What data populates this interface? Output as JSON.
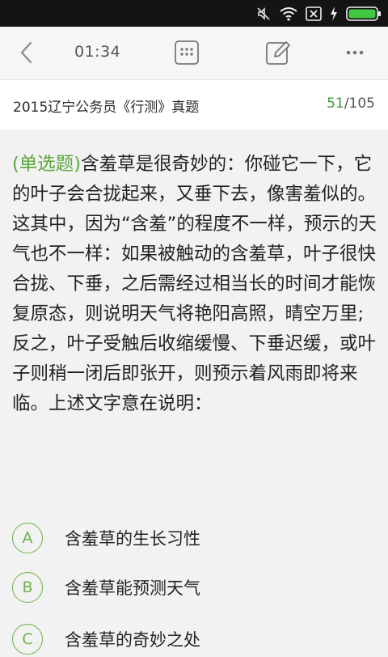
{
  "status_bar": {
    "icons": [
      "mute-icon",
      "wifi-icon",
      "no-sim-icon",
      "charging-icon",
      "battery-icon"
    ],
    "battery_color": "#42c742"
  },
  "toolbar": {
    "time": "01:34",
    "icons": [
      "back-icon",
      "grid-icon",
      "edit-icon",
      "more-icon"
    ]
  },
  "header": {
    "exam_title": "2015辽宁公务员《行测》真题",
    "current": "51",
    "total": "/105"
  },
  "question": {
    "type_label": "(单选题)",
    "text": "含羞草是很奇妙的：你碰它一下，它的叶子会合拢起来，又垂下去，像害羞似的。这其中，因为“含羞”的程度不一样，预示的天气也不一样：如果被触动的含羞草，叶子很快合拢、下垂，之后需经过相当长的时间才能恢复原态，则说明天气将艳阳高照，晴空万里;反之，叶子受触后收缩缓慢、下垂迟缓，或叶子则稍一闭后即张开，则预示着风雨即将来临。上述文字意在说明："
  },
  "options": [
    {
      "letter": "A",
      "text": "含羞草的生长习性"
    },
    {
      "letter": "B",
      "text": "含羞草能预测天气"
    },
    {
      "letter": "C",
      "text": "含羞草的奇妙之处"
    }
  ],
  "colors": {
    "accent_green": "#5aa63c",
    "progress_green": "#3d9a3d"
  }
}
